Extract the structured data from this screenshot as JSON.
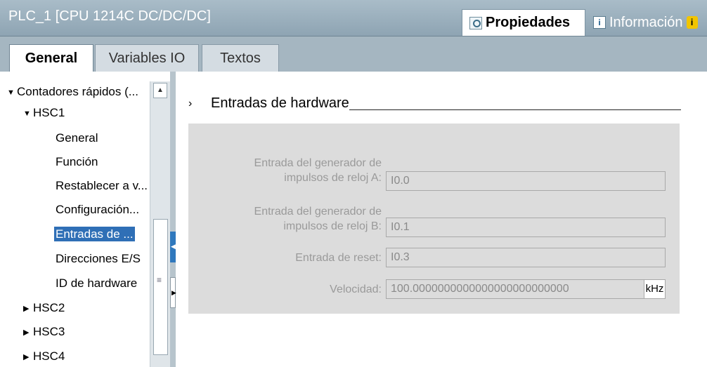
{
  "titlebar": {
    "title": "PLC_1 [CPU 1214C DC/DC/DC]",
    "properties_label": "Propiedades",
    "properties_icon": "magnifier-icon",
    "info_label": "Información",
    "info_icon": "info-icon",
    "warning_icon_glyph": "i"
  },
  "tabs": [
    {
      "label": "General",
      "active": true
    },
    {
      "label": "Variables IO",
      "active": false
    },
    {
      "label": "Textos",
      "active": false
    }
  ],
  "tree": {
    "items": [
      {
        "label": "Contadores rápidos (...",
        "expanded": true,
        "level": 0
      },
      {
        "label": "HSC1",
        "expanded": true,
        "level": 1
      },
      {
        "label": "General",
        "level": 2
      },
      {
        "label": "Función",
        "level": 2
      },
      {
        "label": "Restablecer a v...",
        "level": 2
      },
      {
        "label": "Configuración...",
        "level": 2
      },
      {
        "label": "Entradas de ...",
        "level": 2,
        "selected": true
      },
      {
        "label": "Direcciones E/S",
        "level": 2
      },
      {
        "label": "ID de hardware",
        "level": 2
      },
      {
        "label": "HSC2",
        "expanded": false,
        "level": 1
      },
      {
        "label": "HSC3",
        "expanded": false,
        "level": 1
      },
      {
        "label": "HSC4",
        "expanded": false,
        "level": 1
      }
    ]
  },
  "section": {
    "title": "Entradas de hardware"
  },
  "form": {
    "clock_a_label_1": "Entrada del generador de",
    "clock_a_label_2": "impulsos de reloj A:",
    "clock_a_value": "I0.0",
    "clock_b_label_1": "Entrada del generador de",
    "clock_b_label_2": "impulsos de reloj B:",
    "clock_b_value": "I0.1",
    "reset_label": "Entrada de reset:",
    "reset_value": "I0.3",
    "speed_label": "Velocidad:",
    "speed_value": "100.0000000000000000000000000",
    "speed_unit": "kHz"
  },
  "colors": {
    "selection": "#2f6fb6",
    "titlebar": "#9fb3c0",
    "formbox": "#dcdcdc"
  }
}
